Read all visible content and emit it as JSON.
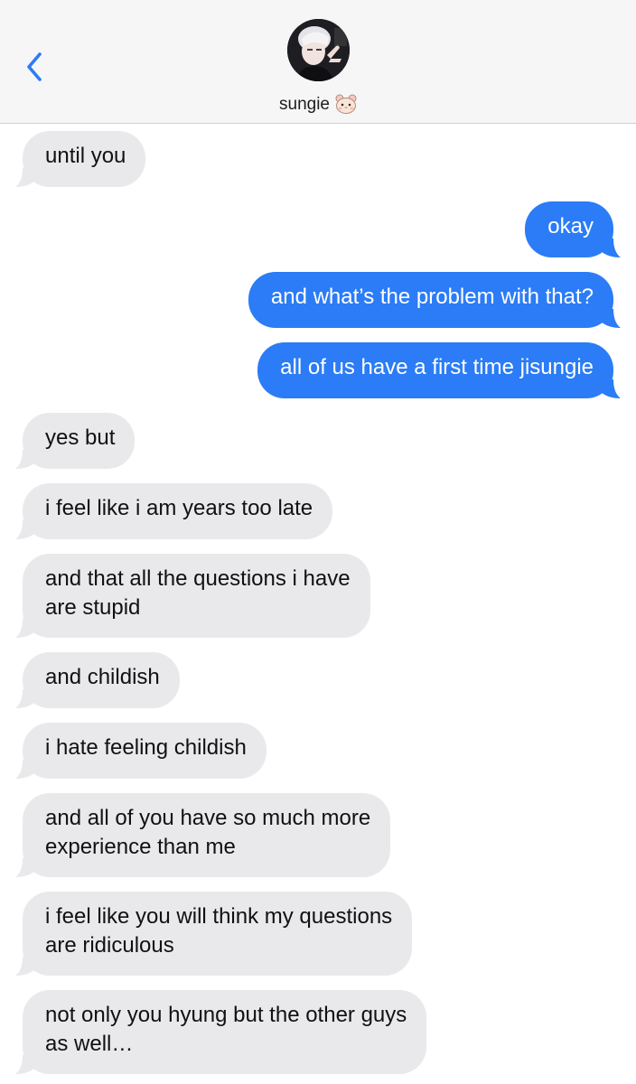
{
  "header": {
    "contact_name": "sungie",
    "contact_emoji": "hamster-face-icon",
    "back_icon": "chevron-left-icon"
  },
  "colors": {
    "accent": "#2b7cf6",
    "incoming_bubble": "#e9e9eb",
    "header_bg": "#f6f6f7"
  },
  "messages": [
    {
      "direction": "incoming",
      "text": "until you"
    },
    {
      "direction": "outgoing",
      "text": "okay"
    },
    {
      "direction": "outgoing",
      "text": "and what’s the problem with that?"
    },
    {
      "direction": "outgoing",
      "text": "all of us have a first time jisungie"
    },
    {
      "direction": "incoming",
      "text": "yes but"
    },
    {
      "direction": "incoming",
      "text": "i feel like i am years too late"
    },
    {
      "direction": "incoming",
      "text": "and that all the questions i have are stupid",
      "lines": [
        "and that all the questions i have",
        "are stupid"
      ]
    },
    {
      "direction": "incoming",
      "text": "and childish"
    },
    {
      "direction": "incoming",
      "text": "i hate feeling childish"
    },
    {
      "direction": "incoming",
      "text": "and all of you have so much more experience than me",
      "lines": [
        "and all of you have so much more",
        "experience than me"
      ]
    },
    {
      "direction": "incoming",
      "text": "i feel like you will think my questions are ridiculous",
      "lines": [
        "i feel like you will think my questions",
        "are ridiculous"
      ]
    },
    {
      "direction": "incoming",
      "text": "not only you hyung but the other guys as well…",
      "lines": [
        "not only you hyung but the other guys",
        "as well…"
      ]
    }
  ]
}
